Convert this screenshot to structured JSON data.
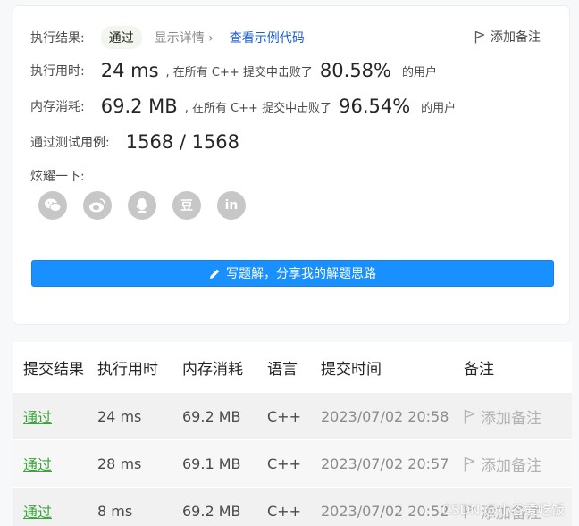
{
  "result": {
    "label": "执行结果:",
    "status": "通过",
    "details": "显示详情 ›",
    "example_code": "查看示例代码",
    "add_note": "添加备注"
  },
  "runtime": {
    "label": "执行用时:",
    "value": "24 ms",
    "text": ", 在所有 C++ 提交中击败了",
    "percent": "80.58%",
    "users": "的用户"
  },
  "memory": {
    "label": "内存消耗:",
    "value": "69.2 MB",
    "text": ", 在所有 C++ 提交中击败了",
    "percent": "96.54%",
    "users": "的用户"
  },
  "tests": {
    "label": "通过测试用例:",
    "value": "1568 / 1568"
  },
  "share": {
    "label": "炫耀一下:",
    "icons": [
      "wechat-icon",
      "weibo-icon",
      "qq-icon",
      "douban-icon",
      "linkedin-icon"
    ],
    "douban_glyph": "豆",
    "linkedin_glyph": "in"
  },
  "write_button": "写题解，分享我的解题思路",
  "table": {
    "headers": [
      "提交结果",
      "执行用时",
      "内存消耗",
      "语言",
      "提交时间",
      "备注"
    ],
    "rows": [
      {
        "status": "通过",
        "runtime": "24 ms",
        "memory": "69.2 MB",
        "lang": "C++",
        "time": "2023/07/02 20:58",
        "note": "添加备注"
      },
      {
        "status": "通过",
        "runtime": "28 ms",
        "memory": "69.1 MB",
        "lang": "C++",
        "time": "2023/07/02 20:57",
        "note": "添加备注"
      },
      {
        "status": "通过",
        "runtime": "8 ms",
        "memory": "69.2 MB",
        "lang": "C++",
        "time": "2023/07/02 20:52",
        "note": "添加备注"
      }
    ]
  },
  "watermark": "CSDN @小谷爱吃饭",
  "colors": {
    "accent": "#1890ff",
    "pass": "#3aa63a",
    "link": "#1a5fd0"
  }
}
